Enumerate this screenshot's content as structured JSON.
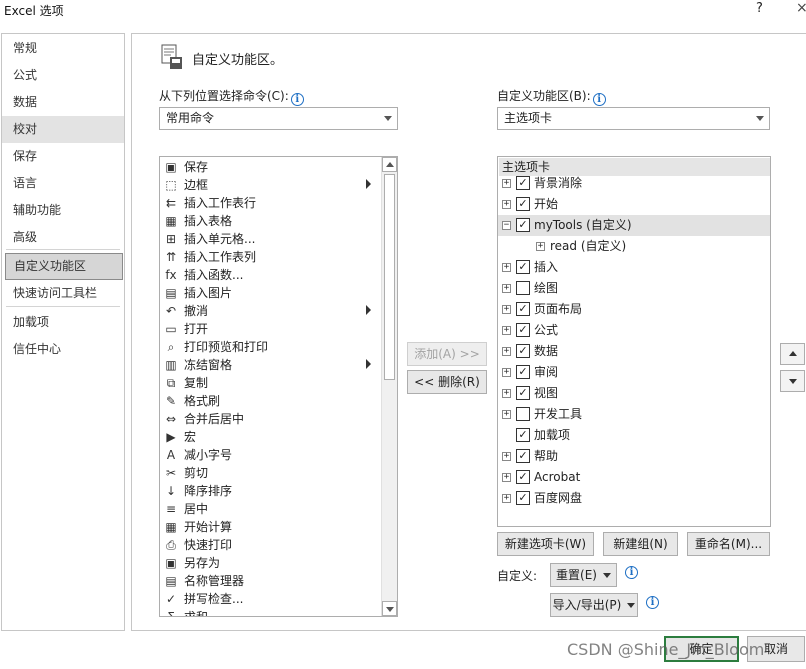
{
  "window": {
    "title": "Excel 选项",
    "help_glyph": "?",
    "close_glyph": "×"
  },
  "nav": {
    "items": [
      {
        "label": "常规"
      },
      {
        "label": "公式"
      },
      {
        "label": "数据"
      },
      {
        "label": "校对"
      },
      {
        "label": "保存"
      },
      {
        "label": "语言"
      },
      {
        "label": "辅助功能"
      },
      {
        "label": "高级"
      },
      {
        "label": "自定义功能区"
      },
      {
        "label": "快速访问工具栏"
      },
      {
        "label": "加载项"
      },
      {
        "label": "信任中心"
      }
    ],
    "selected": "自定义功能区",
    "hovered": "校对"
  },
  "header": {
    "title": "自定义功能区。"
  },
  "left": {
    "label": "从下列位置选择命令(C):",
    "combo_value": "常用命令",
    "commands": [
      {
        "label": "保存",
        "icon": "save-icon",
        "glyph": "▣"
      },
      {
        "label": "边框",
        "icon": "border-icon",
        "glyph": "⬚",
        "submenu": true
      },
      {
        "label": "插入工作表行",
        "icon": "insert-row-icon",
        "glyph": "⇇"
      },
      {
        "label": "插入表格",
        "icon": "insert-table-icon",
        "glyph": "▦"
      },
      {
        "label": "插入单元格...",
        "icon": "insert-cells-icon",
        "glyph": "⊞"
      },
      {
        "label": "插入工作表列",
        "icon": "insert-column-icon",
        "glyph": "⇈"
      },
      {
        "label": "插入函数...",
        "icon": "function-icon",
        "glyph": "fx"
      },
      {
        "label": "插入图片",
        "icon": "picture-icon",
        "glyph": "▤"
      },
      {
        "label": "撤消",
        "icon": "undo-icon",
        "glyph": "↶",
        "submenu": true
      },
      {
        "label": "打开",
        "icon": "folder-icon",
        "glyph": "▭"
      },
      {
        "label": "打印预览和打印",
        "icon": "print-preview-icon",
        "glyph": "⌕"
      },
      {
        "label": "冻结窗格",
        "icon": "freeze-panes-icon",
        "glyph": "▥",
        "submenu": true
      },
      {
        "label": "复制",
        "icon": "copy-icon",
        "glyph": "⧉"
      },
      {
        "label": "格式刷",
        "icon": "format-painter-icon",
        "glyph": "✎"
      },
      {
        "label": "合并后居中",
        "icon": "merge-center-icon",
        "glyph": "⇔"
      },
      {
        "label": "宏",
        "icon": "macro-icon",
        "glyph": "▶"
      },
      {
        "label": "减小字号",
        "icon": "decrease-font-icon",
        "glyph": "A"
      },
      {
        "label": "剪切",
        "icon": "cut-icon",
        "glyph": "✂"
      },
      {
        "label": "降序排序",
        "icon": "sort-desc-icon",
        "glyph": "↓"
      },
      {
        "label": "居中",
        "icon": "center-align-icon",
        "glyph": "≡"
      },
      {
        "label": "开始计算",
        "icon": "calculator-icon",
        "glyph": "▦"
      },
      {
        "label": "快速打印",
        "icon": "quick-print-icon",
        "glyph": "⎙"
      },
      {
        "label": "另存为",
        "icon": "save-as-icon",
        "glyph": "▣"
      },
      {
        "label": "名称管理器",
        "icon": "name-manager-icon",
        "glyph": "▤"
      },
      {
        "label": "拼写检查...",
        "icon": "spell-check-icon",
        "glyph": "✓"
      },
      {
        "label": "求和",
        "icon": "sum-icon",
        "glyph": "Σ"
      }
    ]
  },
  "middle": {
    "add_label": "添加(A) >>",
    "remove_label": "<< 删除(R)"
  },
  "right": {
    "label": "自定义功能区(B):",
    "combo_value": "主选项卡",
    "tree_header": "主选项卡",
    "tabs": [
      {
        "label": "背景消除",
        "checked": true,
        "expandable": true,
        "indent": 0
      },
      {
        "label": "开始",
        "checked": true,
        "expandable": true,
        "indent": 0
      },
      {
        "label": "myTools (自定义)",
        "checked": true,
        "expandable": true,
        "expanded": true,
        "indent": 0,
        "selected": true
      },
      {
        "label": "read (自定义)",
        "checked": null,
        "expandable": true,
        "indent": 1
      },
      {
        "label": "插入",
        "checked": true,
        "expandable": true,
        "indent": 0
      },
      {
        "label": "绘图",
        "checked": false,
        "expandable": true,
        "indent": 0
      },
      {
        "label": "页面布局",
        "checked": true,
        "expandable": true,
        "indent": 0
      },
      {
        "label": "公式",
        "checked": true,
        "expandable": true,
        "indent": 0
      },
      {
        "label": "数据",
        "checked": true,
        "expandable": true,
        "indent": 0
      },
      {
        "label": "审阅",
        "checked": true,
        "expandable": true,
        "indent": 0
      },
      {
        "label": "视图",
        "checked": true,
        "expandable": true,
        "indent": 0
      },
      {
        "label": "开发工具",
        "checked": false,
        "expandable": true,
        "indent": 0
      },
      {
        "label": "加载项",
        "checked": true,
        "expandable": false,
        "indent": 0
      },
      {
        "label": "帮助",
        "checked": true,
        "expandable": true,
        "indent": 0
      },
      {
        "label": "Acrobat",
        "checked": true,
        "expandable": true,
        "indent": 0
      },
      {
        "label": "百度网盘",
        "checked": true,
        "expandable": true,
        "indent": 0
      }
    ],
    "new_tab_label": "新建选项卡(W)",
    "new_group_label": "新建组(N)",
    "rename_label": "重命名(M)...",
    "custom_label": "自定义:",
    "reset_label": "重置(E)",
    "import_export_label": "导入/导出(P)"
  },
  "footer": {
    "ok_label": "确定",
    "cancel_label": "取消"
  },
  "watermark": "CSDN @Shine_Jin_Bloom",
  "colors": {
    "accent": "#2c7d3f",
    "info": "#1e6fc4",
    "selected_bg": "#d6d6d6"
  }
}
